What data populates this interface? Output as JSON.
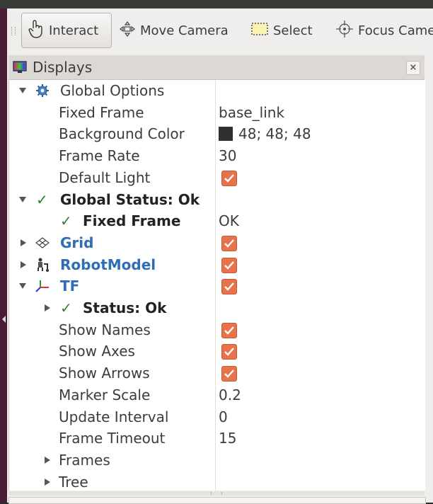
{
  "toolbar": {
    "tools": [
      {
        "label": "Interact",
        "icon": "hand-pointer-icon",
        "active": true
      },
      {
        "label": "Move Camera",
        "icon": "move-camera-icon",
        "active": false
      },
      {
        "label": "Select",
        "icon": "select-rect-icon",
        "active": false
      },
      {
        "label": "Focus Came",
        "icon": "focus-camera-icon",
        "active": false
      }
    ]
  },
  "panel": {
    "title": "Displays",
    "close_label": "×"
  },
  "tree": {
    "global_options": {
      "label": "Global Options"
    },
    "fixed_frame": {
      "label": "Fixed Frame",
      "value": "base_link"
    },
    "background_color": {
      "label": "Background Color",
      "value": "48; 48; 48",
      "color": "#303030"
    },
    "frame_rate": {
      "label": "Frame Rate",
      "value": "30"
    },
    "default_light": {
      "label": "Default Light",
      "checked": true
    },
    "global_status": {
      "label": "Global Status: Ok",
      "check": "✓"
    },
    "status_fixed_frame": {
      "label": "Fixed Frame",
      "value": "OK",
      "check": "✓"
    },
    "grid": {
      "label": "Grid",
      "checked": true
    },
    "robot_model": {
      "label": "RobotModel",
      "checked": true
    },
    "tf": {
      "label": "TF",
      "checked": true
    },
    "tf_status": {
      "label": "Status: Ok",
      "check": "✓"
    },
    "show_names": {
      "label": "Show Names",
      "checked": true
    },
    "show_axes": {
      "label": "Show Axes",
      "checked": true
    },
    "show_arrows": {
      "label": "Show Arrows",
      "checked": true
    },
    "marker_scale": {
      "label": "Marker Scale",
      "value": "0.2"
    },
    "update_interval": {
      "label": "Update Interval",
      "value": "0"
    },
    "frame_timeout": {
      "label": "Frame Timeout",
      "value": "15"
    },
    "frames": {
      "label": "Frames"
    },
    "tree_item": {
      "label": "Tree"
    }
  },
  "colors": {
    "checkbox": "#e8734a",
    "link_blue": "#2f6db5",
    "ok_green": "#2e7d32"
  }
}
